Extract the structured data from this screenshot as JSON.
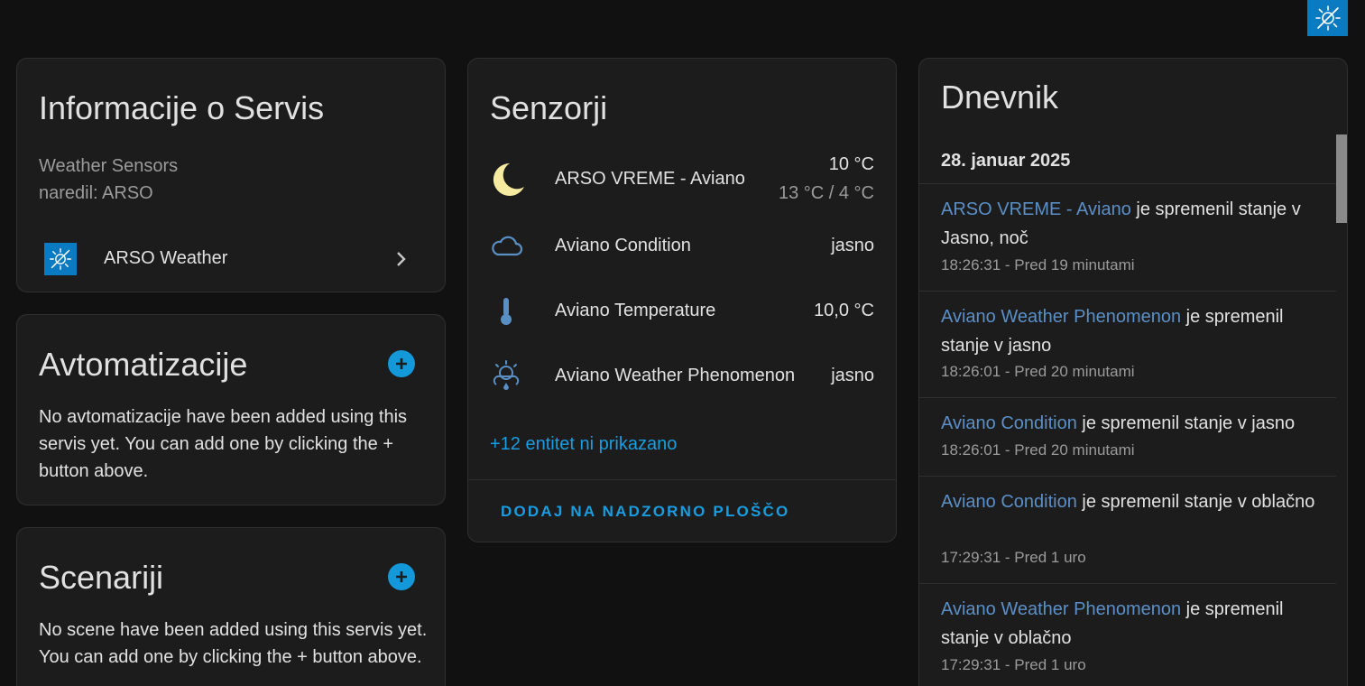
{
  "info": {
    "title": "Informacije o Servis",
    "model": "Weather Sensors",
    "manufacturer": "naredil: ARSO",
    "integration": "ARSO Weather"
  },
  "automations": {
    "title": "Avtomatizacije",
    "empty_text": "No avtomatizacije have been added using this servis yet. You can add one by clicking the + button above."
  },
  "scenes": {
    "title": "Scenariji",
    "empty_text": "No scene have been added using this servis yet. You can add one by clicking the + button above."
  },
  "sensors": {
    "title": "Senzorji",
    "entities": [
      {
        "name": "ARSO VREME - Aviano",
        "state": "10 °C",
        "sub": "13 °C / 4 °C",
        "icon": "moon-icon"
      },
      {
        "name": "Aviano Condition",
        "state": "jasno",
        "icon": "cloud-icon"
      },
      {
        "name": "Aviano Temperature",
        "state": "10,0 °C",
        "icon": "thermometer-icon"
      },
      {
        "name": "Aviano Weather Phenomenon",
        "state": "jasno",
        "icon": "weather-phenomenon-icon"
      }
    ],
    "more": "+12 entitet ni prikazano",
    "action": "DODAJ NA NADZORNO PLOŠČO"
  },
  "logbook": {
    "title": "Dnevnik",
    "date": "28. januar 2025",
    "entries": [
      {
        "entity": "ARSO VREME - Aviano",
        "msg": " je spremenil stanje v Jasno, noč",
        "time": "18:26:31 - Pred 19 minutami"
      },
      {
        "entity": "Aviano Weather Phenomenon",
        "msg": " je spremenil stanje v jasno",
        "time": "18:26:01 - Pred 20 minutami"
      },
      {
        "entity": "Aviano Condition",
        "msg": " je spremenil stanje v jasno",
        "time": "18:26:01 - Pred 20 minutami"
      },
      {
        "entity": "Aviano Condition",
        "msg": " je spremenil stanje v oblačno",
        "time": "17:29:31 - Pred 1 uro"
      },
      {
        "entity": "Aviano Weather Phenomenon",
        "msg": " je spremenil stanje v oblačno",
        "time": "17:29:31 - Pred 1 uro"
      }
    ]
  },
  "colors": {
    "background": "#111111",
    "card": "#1c1c1c",
    "accent": "#1398d9",
    "entity_link": "#5b8fc7",
    "moon": "#f6e9a0",
    "icon_blue": "#5a8fc4"
  }
}
